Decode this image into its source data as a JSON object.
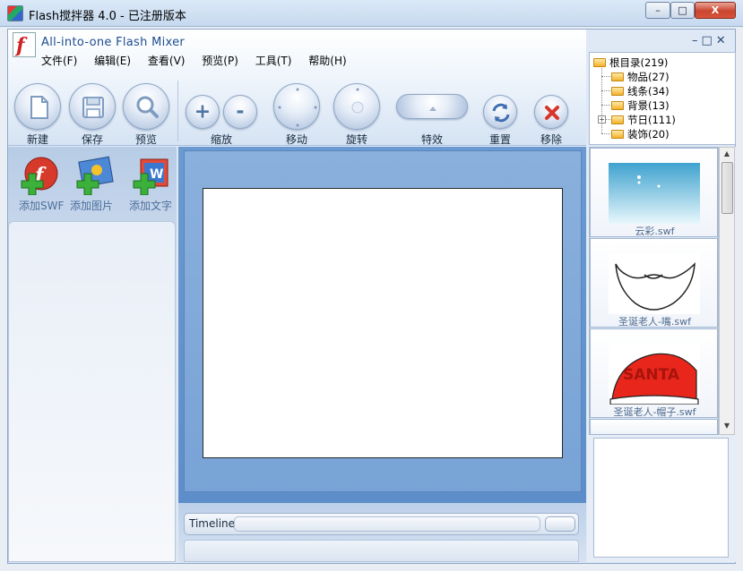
{
  "window": {
    "title": "Flash搅拌器 4.0 - 已注册版本",
    "controls": {
      "minimize": "–",
      "maximize": "□",
      "close": "X"
    }
  },
  "app": {
    "name": "All-into-one Flash Mixer",
    "mdi_controls": "–□✕"
  },
  "menu": [
    "文件(F)",
    "编辑(E)",
    "查看(V)",
    "预览(P)",
    "工具(T)",
    "帮助(H)"
  ],
  "toolbar": {
    "new": "新建",
    "save": "保存",
    "preview": "预览",
    "zoom": "缩放",
    "move": "移动",
    "rotate": "旋转",
    "effects": "特效",
    "reset": "重置",
    "remove": "移除"
  },
  "tree": {
    "root": "根目录(219)",
    "items": [
      "物品(27)",
      "线条(34)",
      "背景(13)",
      "节日(111)",
      "装饰(20)"
    ]
  },
  "add_panel": {
    "add_swf": "添加SWF",
    "add_image": "添加图片",
    "add_text": "添加文字"
  },
  "timeline": {
    "label": "Timeline"
  },
  "library": {
    "items": [
      {
        "name": "云彩.swf",
        "icon": "clouds-thumbnail"
      },
      {
        "name": "圣诞老人-嘴.swf",
        "icon": "santa-beard-thumbnail"
      },
      {
        "name": "圣诞老人-帽子.swf",
        "icon": "santa-hat-thumbnail",
        "text": "SANTA"
      }
    ]
  },
  "colors": {
    "accent": "#5d8ec9",
    "close_button": "#c9452f",
    "stage": "#ffffff"
  }
}
